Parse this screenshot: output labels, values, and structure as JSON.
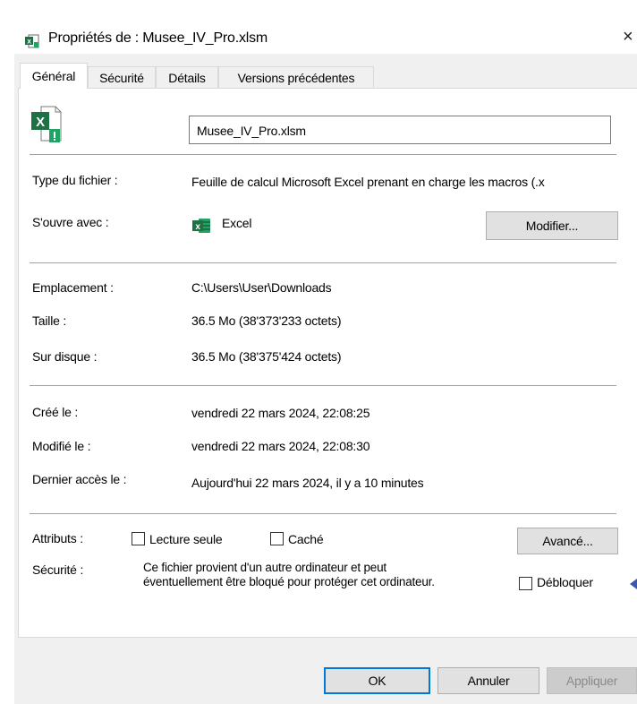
{
  "window": {
    "title": "Propriétés de : Musee_IV_Pro.xlsm"
  },
  "tabs": [
    {
      "label": "Général"
    },
    {
      "label": "Sécurité"
    },
    {
      "label": "Détails"
    },
    {
      "label": "Versions précédentes"
    }
  ],
  "general": {
    "file_name": "Musee_IV_Pro.xlsm",
    "type_label": "Type du fichier :",
    "type_value": "Feuille de calcul Microsoft Excel prenant en charge les macros (.x",
    "opens_label": "S'ouvre avec :",
    "opens_value": "Excel",
    "change_button": "Modifier...",
    "location_label": "Emplacement :",
    "location_value": "C:\\Users\\User\\Downloads",
    "size_label": "Taille :",
    "size_value": "36.5 Mo (38'373'233 octets)",
    "disk_label": "Sur disque :",
    "disk_value": "36.5 Mo (38'375'424 octets)",
    "created_label": "Créé le :",
    "created_value": "vendredi 22 mars 2024, 22:08:25",
    "modified_label": "Modifié le :",
    "modified_value": "vendredi 22 mars 2024, 22:08:30",
    "accessed_label": "Dernier accès le :",
    "accessed_value": "Aujourd'hui 22 mars 2024, il y a 10 minutes",
    "attributes_label": "Attributs :",
    "readonly_label": "Lecture seule",
    "hidden_label": "Caché",
    "advanced_button": "Avancé...",
    "security_label": "Sécurité :",
    "security_text_1": "Ce fichier provient d'un autre ordinateur et peut",
    "security_text_2": "éventuellement être bloqué pour protéger cet ordinateur.",
    "unblock_label": "Débloquer"
  },
  "footer": {
    "ok": "OK",
    "cancel": "Annuler",
    "apply": "Appliquer"
  },
  "colors": {
    "excel_green": "#1e7145",
    "warning_green": "#21a366",
    "accent_blue": "#0078d7"
  }
}
